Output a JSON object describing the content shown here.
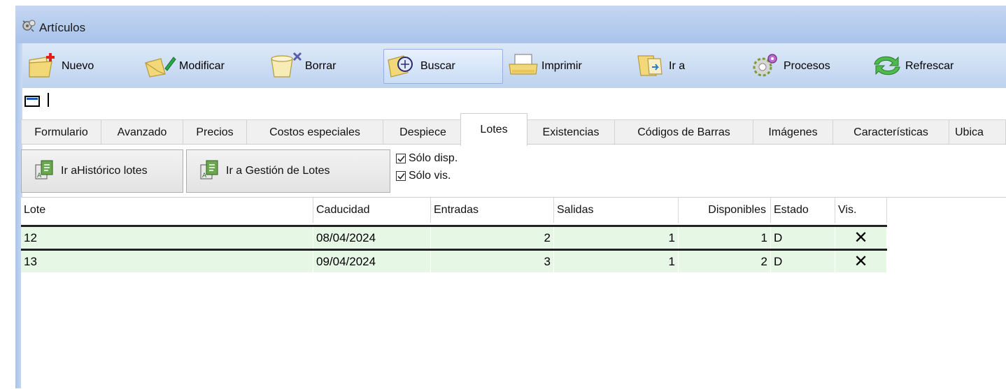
{
  "window": {
    "title": "Artículos",
    "icon": "gear-clock-icon"
  },
  "toolbar": {
    "buttons": [
      {
        "label": "Nuevo",
        "icon": "new-folder-icon"
      },
      {
        "label": "Modificar",
        "icon": "edit-folder-icon"
      },
      {
        "label": "Borrar",
        "icon": "delete-bucket-icon"
      },
      {
        "label": "Buscar",
        "icon": "search-folder-icon"
      },
      {
        "label": "Imprimir",
        "icon": "printer-icon"
      },
      {
        "label": "Ir a",
        "icon": "goto-book-icon"
      },
      {
        "label": "Procesos",
        "icon": "gears-icon"
      },
      {
        "label": "Refrescar",
        "icon": "refresh-arrows-icon"
      }
    ]
  },
  "tabs": [
    {
      "label": "Formulario"
    },
    {
      "label": "Avanzado"
    },
    {
      "label": "Precios"
    },
    {
      "label": "Costos especiales"
    },
    {
      "label": "Despiece"
    },
    {
      "label": "Lotes",
      "active": true
    },
    {
      "label": "Existencias"
    },
    {
      "label": "Códigos de Barras"
    },
    {
      "label": "Imágenes"
    },
    {
      "label": "Características"
    },
    {
      "label": "Ubica"
    }
  ],
  "lotes": {
    "btn_historico": "Ir aHistórico lotes",
    "btn_gestion": "Ir a Gestión de Lotes",
    "chk_disp": {
      "label": "Sólo disp.",
      "checked": true
    },
    "chk_vis": {
      "label": "Sólo vis.",
      "checked": true
    }
  },
  "grid": {
    "columns": [
      "Lote",
      "Caducidad",
      "Entradas",
      "Salidas",
      "Disponibles",
      "Estado",
      "Vis."
    ],
    "rows": [
      {
        "lote": "12",
        "caducidad": "08/04/2024",
        "entradas": "2",
        "salidas": "1",
        "disponibles": "1",
        "estado": "D",
        "vis": "✕"
      },
      {
        "lote": "13",
        "caducidad": "09/04/2024",
        "entradas": "3",
        "salidas": "1",
        "disponibles": "2",
        "estado": "D",
        "vis": "✕"
      }
    ],
    "row_color": "#e6f7e6"
  }
}
